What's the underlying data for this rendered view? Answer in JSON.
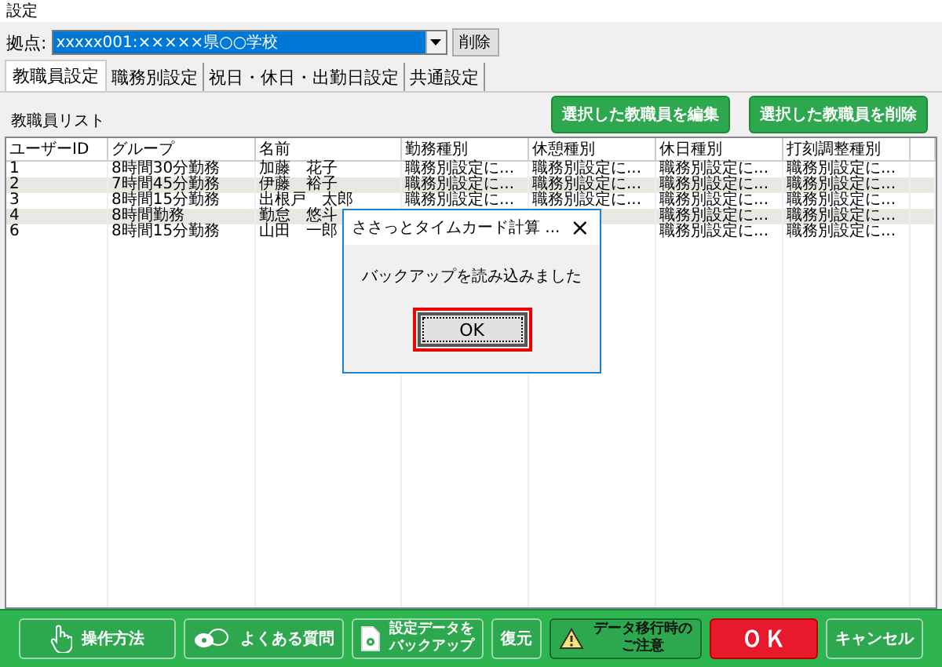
{
  "window": {
    "title": "設定"
  },
  "location": {
    "label": "拠点:",
    "value": "xxxxx001:×××××県○○学校",
    "delete_button": "削除"
  },
  "tabs": [
    {
      "label": "教職員設定",
      "selected": true
    },
    {
      "label": "職務別設定",
      "selected": false
    },
    {
      "label": "祝日・休日・出勤日設定",
      "selected": false
    },
    {
      "label": "共通設定",
      "selected": false
    }
  ],
  "list_title": "教職員リスト",
  "actions": [
    "選択した教職員を編集",
    "選択した教職員を削除"
  ],
  "table": {
    "columns": [
      "ユーザーID",
      "グループ",
      "名前",
      "勤務種別",
      "休憩種別",
      "休日種別",
      "打刻調整種別"
    ],
    "rows": [
      {
        "cells": [
          "1",
          "8時間30分勤務",
          "加藤　花子",
          "職務別設定に...",
          "職務別設定に...",
          "職務別設定に...",
          "職務別設定に..."
        ]
      },
      {
        "cells": [
          "2",
          "7時間45分勤務",
          "伊藤　裕子",
          "職務別設定に...",
          "職務別設定に...",
          "職務別設定に...",
          "職務別設定に..."
        ]
      },
      {
        "cells": [
          "3",
          "8時間15分勤務",
          "出根戸　太郎",
          "職務別設定に...",
          "職務別設定に...",
          "職務別設定に...",
          "職務別設定に..."
        ]
      },
      {
        "cells": [
          "4",
          "8時間勤務",
          "勤怠　悠斗",
          null,
          null,
          "職務別設定に...",
          "職務別設定に..."
        ]
      },
      {
        "cells": [
          "6",
          "8時間15分勤務",
          "山田　一郎",
          null,
          null,
          "職務別設定に...",
          "職務別設定に..."
        ]
      }
    ]
  },
  "dialog": {
    "title": "ささっとタイムカード計算 ...",
    "close": "×",
    "message": "バックアップを読み込みました",
    "button": "OK"
  },
  "footer": [
    {
      "kind": "hand",
      "label": "操作方法"
    },
    {
      "kind": "chat",
      "label": "よくある質問"
    },
    {
      "kind": "doc",
      "label": "設定データをバックアップ"
    },
    {
      "kind": "plain",
      "label": "復元"
    },
    {
      "kind": "warn",
      "label": "データ移行時のご注意"
    },
    {
      "kind": "ok",
      "label": "ＯＫ"
    },
    {
      "kind": "plain",
      "label": "キャンセル"
    }
  ]
}
